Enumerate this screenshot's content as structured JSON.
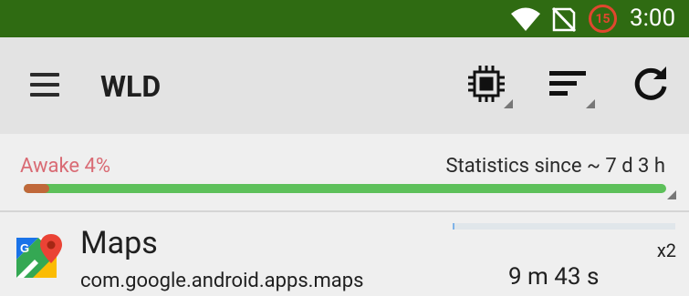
{
  "status_bar": {
    "time": "3:00",
    "badge_count": "15",
    "icons": [
      "wifi-icon",
      "no-signal-icon",
      "battery-saver-badge"
    ],
    "background_color": "#2f6b12"
  },
  "toolbar": {
    "title": "WLD",
    "icons": [
      "menu-icon",
      "cpu-icon",
      "sort-icon",
      "refresh-icon"
    ]
  },
  "stats": {
    "awake_label": "Awake 4%",
    "awake_fraction": 0.04,
    "since_label": "Statistics since ~ 7 d 3 h",
    "colors": {
      "awake": "#c0683a",
      "remaining": "#5dc05a",
      "awake_text": "#d96b74"
    }
  },
  "apps": [
    {
      "name": "Maps",
      "package": "com.google.android.apps.maps",
      "count": "x2",
      "duration": "9 m 43 s",
      "usage_fraction": 0.01,
      "icon": "google-maps-icon"
    }
  ]
}
